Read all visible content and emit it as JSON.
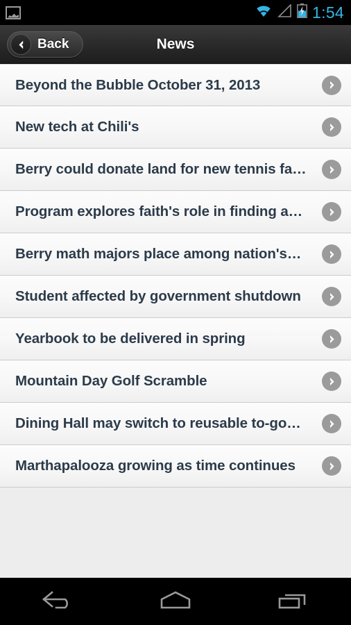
{
  "status_bar": {
    "notification_icon": "photo-icon",
    "wifi_icon": "wifi-icon",
    "signal_icon": "cellular-signal-icon",
    "battery_icon": "battery-charging-icon",
    "time": "1:54",
    "time_color": "#34b6e4"
  },
  "action_bar": {
    "back_label": "Back",
    "back_icon": "chevron-left-icon",
    "title": "News"
  },
  "list": {
    "chevron_icon": "chevron-right-icon",
    "items": [
      {
        "title": "Beyond the Bubble October 31, 2013"
      },
      {
        "title": "New tech at Chili's"
      },
      {
        "title": "Berry could donate land for new tennis fa…"
      },
      {
        "title": "Program explores faith's role in finding a…"
      },
      {
        "title": "Berry math majors place among nation's…"
      },
      {
        "title": "Student affected by government shutdown"
      },
      {
        "title": "Yearbook to be delivered in spring"
      },
      {
        "title": "Mountain Day Golf Scramble"
      },
      {
        "title": "Dining Hall may switch to reusable to-go…"
      },
      {
        "title": "Marthapalooza growing as time continues"
      }
    ]
  },
  "nav_bar": {
    "back_icon": "system-back-icon",
    "home_icon": "system-home-icon",
    "recents_icon": "system-recents-icon"
  },
  "colors": {
    "accent": "#34b6e4",
    "row_text": "#2c3b4a",
    "chevron_bg": "#9b9b9b",
    "page_bg": "#ededed"
  }
}
